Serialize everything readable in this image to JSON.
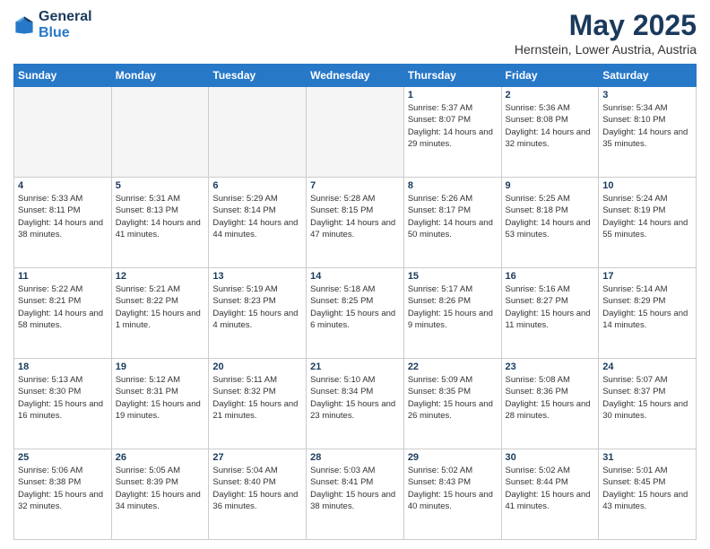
{
  "header": {
    "logo_line1": "General",
    "logo_line2": "Blue",
    "month_title": "May 2025",
    "location": "Hernstein, Lower Austria, Austria"
  },
  "weekdays": [
    "Sunday",
    "Monday",
    "Tuesday",
    "Wednesday",
    "Thursday",
    "Friday",
    "Saturday"
  ],
  "weeks": [
    [
      {
        "day": "",
        "empty": true
      },
      {
        "day": "",
        "empty": true
      },
      {
        "day": "",
        "empty": true
      },
      {
        "day": "",
        "empty": true
      },
      {
        "day": "1",
        "sunrise": "5:37 AM",
        "sunset": "8:07 PM",
        "daylight": "14 hours and 29 minutes."
      },
      {
        "day": "2",
        "sunrise": "5:36 AM",
        "sunset": "8:08 PM",
        "daylight": "14 hours and 32 minutes."
      },
      {
        "day": "3",
        "sunrise": "5:34 AM",
        "sunset": "8:10 PM",
        "daylight": "14 hours and 35 minutes."
      }
    ],
    [
      {
        "day": "4",
        "sunrise": "5:33 AM",
        "sunset": "8:11 PM",
        "daylight": "14 hours and 38 minutes."
      },
      {
        "day": "5",
        "sunrise": "5:31 AM",
        "sunset": "8:13 PM",
        "daylight": "14 hours and 41 minutes."
      },
      {
        "day": "6",
        "sunrise": "5:29 AM",
        "sunset": "8:14 PM",
        "daylight": "14 hours and 44 minutes."
      },
      {
        "day": "7",
        "sunrise": "5:28 AM",
        "sunset": "8:15 PM",
        "daylight": "14 hours and 47 minutes."
      },
      {
        "day": "8",
        "sunrise": "5:26 AM",
        "sunset": "8:17 PM",
        "daylight": "14 hours and 50 minutes."
      },
      {
        "day": "9",
        "sunrise": "5:25 AM",
        "sunset": "8:18 PM",
        "daylight": "14 hours and 53 minutes."
      },
      {
        "day": "10",
        "sunrise": "5:24 AM",
        "sunset": "8:19 PM",
        "daylight": "14 hours and 55 minutes."
      }
    ],
    [
      {
        "day": "11",
        "sunrise": "5:22 AM",
        "sunset": "8:21 PM",
        "daylight": "14 hours and 58 minutes."
      },
      {
        "day": "12",
        "sunrise": "5:21 AM",
        "sunset": "8:22 PM",
        "daylight": "15 hours and 1 minute."
      },
      {
        "day": "13",
        "sunrise": "5:19 AM",
        "sunset": "8:23 PM",
        "daylight": "15 hours and 4 minutes."
      },
      {
        "day": "14",
        "sunrise": "5:18 AM",
        "sunset": "8:25 PM",
        "daylight": "15 hours and 6 minutes."
      },
      {
        "day": "15",
        "sunrise": "5:17 AM",
        "sunset": "8:26 PM",
        "daylight": "15 hours and 9 minutes."
      },
      {
        "day": "16",
        "sunrise": "5:16 AM",
        "sunset": "8:27 PM",
        "daylight": "15 hours and 11 minutes."
      },
      {
        "day": "17",
        "sunrise": "5:14 AM",
        "sunset": "8:29 PM",
        "daylight": "15 hours and 14 minutes."
      }
    ],
    [
      {
        "day": "18",
        "sunrise": "5:13 AM",
        "sunset": "8:30 PM",
        "daylight": "15 hours and 16 minutes."
      },
      {
        "day": "19",
        "sunrise": "5:12 AM",
        "sunset": "8:31 PM",
        "daylight": "15 hours and 19 minutes."
      },
      {
        "day": "20",
        "sunrise": "5:11 AM",
        "sunset": "8:32 PM",
        "daylight": "15 hours and 21 minutes."
      },
      {
        "day": "21",
        "sunrise": "5:10 AM",
        "sunset": "8:34 PM",
        "daylight": "15 hours and 23 minutes."
      },
      {
        "day": "22",
        "sunrise": "5:09 AM",
        "sunset": "8:35 PM",
        "daylight": "15 hours and 26 minutes."
      },
      {
        "day": "23",
        "sunrise": "5:08 AM",
        "sunset": "8:36 PM",
        "daylight": "15 hours and 28 minutes."
      },
      {
        "day": "24",
        "sunrise": "5:07 AM",
        "sunset": "8:37 PM",
        "daylight": "15 hours and 30 minutes."
      }
    ],
    [
      {
        "day": "25",
        "sunrise": "5:06 AM",
        "sunset": "8:38 PM",
        "daylight": "15 hours and 32 minutes."
      },
      {
        "day": "26",
        "sunrise": "5:05 AM",
        "sunset": "8:39 PM",
        "daylight": "15 hours and 34 minutes."
      },
      {
        "day": "27",
        "sunrise": "5:04 AM",
        "sunset": "8:40 PM",
        "daylight": "15 hours and 36 minutes."
      },
      {
        "day": "28",
        "sunrise": "5:03 AM",
        "sunset": "8:41 PM",
        "daylight": "15 hours and 38 minutes."
      },
      {
        "day": "29",
        "sunrise": "5:02 AM",
        "sunset": "8:43 PM",
        "daylight": "15 hours and 40 minutes."
      },
      {
        "day": "30",
        "sunrise": "5:02 AM",
        "sunset": "8:44 PM",
        "daylight": "15 hours and 41 minutes."
      },
      {
        "day": "31",
        "sunrise": "5:01 AM",
        "sunset": "8:45 PM",
        "daylight": "15 hours and 43 minutes."
      }
    ]
  ]
}
